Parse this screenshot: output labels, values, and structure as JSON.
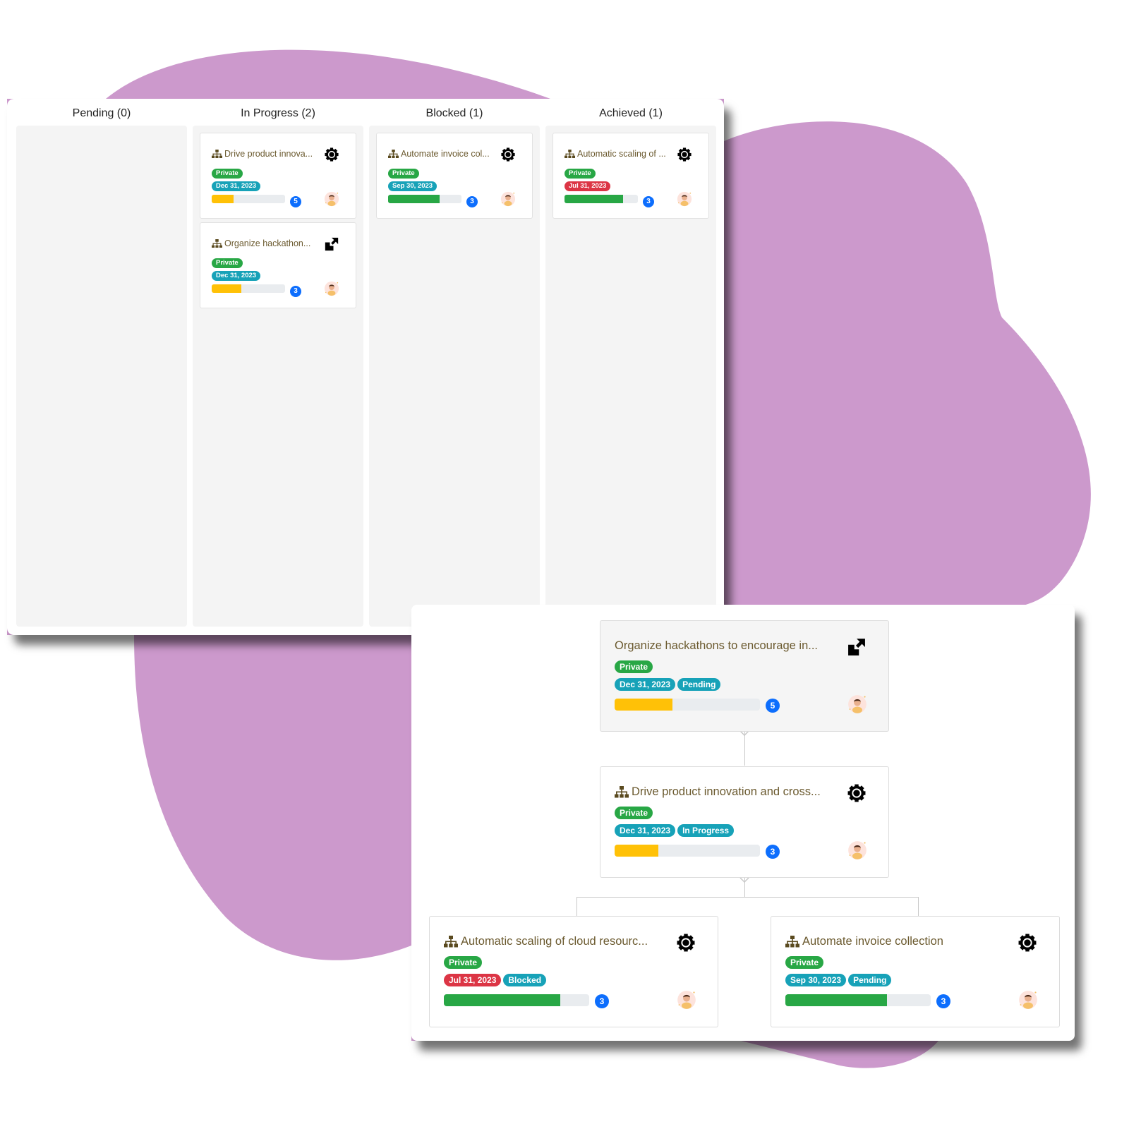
{
  "colors": {
    "blob": "#cc99cc",
    "private": "#28a745",
    "info": "#17a2b8",
    "danger": "#dc3545",
    "progress_warning": "#ffc107",
    "progress_success": "#28a745",
    "count_badge": "#0d6efd",
    "title_text": "#6b5a2f"
  },
  "kanban": {
    "columns": [
      {
        "label": "Pending (0)",
        "cards": []
      },
      {
        "label": "In Progress (2)",
        "cards": [
          {
            "title": "Drive product innovation and cross-functional collaboration",
            "title_display": "Drive product innova...",
            "icon": "sitemap-icon",
            "action_icon": "gear-icon",
            "visibility": "Private",
            "date": "Dec 31, 2023",
            "date_color": "info",
            "progress": 0.3,
            "progress_color": "warning",
            "count": "5"
          },
          {
            "title": "Organize hackathons to encourage innovation",
            "title_display": "Organize hackathon...",
            "icon": "sitemap-icon",
            "action_icon": "expand-icon",
            "visibility": "Private",
            "date": "Dec 31, 2023",
            "date_color": "info",
            "progress": 0.4,
            "progress_color": "warning",
            "count": "3"
          }
        ]
      },
      {
        "label": "Blocked (1)",
        "cards": [
          {
            "title": "Automate invoice collection",
            "title_display": "Automate invoice col...",
            "icon": "sitemap-icon",
            "action_icon": "gear-icon",
            "visibility": "Private",
            "date": "Sep 30, 2023",
            "date_color": "info",
            "progress": 0.7,
            "progress_color": "success",
            "count": "3"
          }
        ]
      },
      {
        "label": "Achieved (1)",
        "cards": [
          {
            "title": "Automatic scaling of cloud resources",
            "title_display": "Automatic scaling of ...",
            "icon": "sitemap-icon",
            "action_icon": "gear-icon",
            "visibility": "Private",
            "date": "Jul 31, 2023",
            "date_color": "danger",
            "progress": 0.8,
            "progress_color": "success",
            "count": "3"
          }
        ]
      }
    ]
  },
  "tree": {
    "nodes": [
      {
        "title": "Organize hackathons to encourage in...",
        "show_icon": false,
        "action_icon": "expand-icon",
        "visibility": "Private",
        "date": "Dec 31, 2023",
        "date_color": "info",
        "status": "Pending",
        "progress": 0.4,
        "progress_color": "warning",
        "count": "5",
        "highlight": true
      },
      {
        "title": "Drive product innovation and cross...",
        "show_icon": true,
        "action_icon": "gear-icon",
        "visibility": "Private",
        "date": "Dec 31, 2023",
        "date_color": "info",
        "status": "In Progress",
        "progress": 0.3,
        "progress_color": "warning",
        "count": "3",
        "highlight": false
      },
      {
        "title": "Automatic scaling of cloud resourc...",
        "show_icon": true,
        "action_icon": "gear-icon",
        "visibility": "Private",
        "date": "Jul 31, 2023",
        "date_color": "danger",
        "status": "Blocked",
        "progress": 0.8,
        "progress_color": "success",
        "count": "3",
        "highlight": false
      },
      {
        "title": "Automate invoice collection",
        "show_icon": true,
        "action_icon": "gear-icon",
        "visibility": "Private",
        "date": "Sep 30, 2023",
        "date_color": "info",
        "status": "Pending",
        "progress": 0.7,
        "progress_color": "success",
        "count": "3",
        "highlight": false
      }
    ]
  }
}
